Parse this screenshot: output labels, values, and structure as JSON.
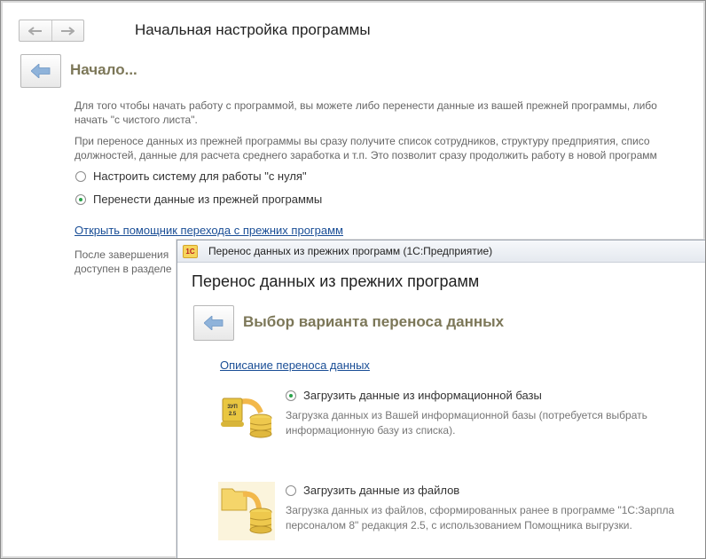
{
  "main": {
    "window_title": "Начальная настройка программы",
    "header": "Начало...",
    "intro_lines": [
      "Для того чтобы начать работу с программой, вы можете либо перенести данные из вашей прежней программы, либо",
      "начать \"с чистого листа\"."
    ],
    "transfer_lines": [
      "При переносе данных из прежней программы вы сразу получите список сотрудников, структуру предприятия, списо",
      "должностей, данные для расчета среднего заработка и т.п. Это позволит сразу продолжить работу в новой программ"
    ],
    "radio_clean": "Настроить систему для работы \"с нуля\"",
    "radio_transfer": "Перенести данные из прежней программы",
    "selected_radio": "radio_transfer",
    "wizard_link": "Открыть помощник перехода с прежних программ",
    "after_lines": [
      "После завершения",
      "доступен в разделе"
    ]
  },
  "dialog": {
    "titlebar": "Перенос данных из прежних программ  (1С:Предприятие)",
    "logo_text": "1С",
    "title": "Перенос данных из прежних программ",
    "header": "Выбор варианта переноса данных",
    "description_link": "Описание переноса данных",
    "option_infobase": {
      "label": "Загрузить данные из информационной базы",
      "desc_lines": [
        "Загрузка данных из Вашей информационной базы (потребуется выбрать",
        "информационную базу из списка)."
      ],
      "icon_text": "ЗУП 2.5",
      "selected": true
    },
    "option_files": {
      "label": "Загрузить данные из файлов",
      "desc_lines": [
        "Загрузка данных из файлов, сформированных ранее в программе \"1С:Зарпла",
        "персоналом 8\" редакция 2.5, с использованием Помощника выгрузки."
      ],
      "selected": false
    }
  },
  "colors": {
    "header_text": "#7c7758",
    "link": "#1a4e96",
    "radio_selected": "#2aa34a",
    "back_arrow": "#8fb3da"
  }
}
